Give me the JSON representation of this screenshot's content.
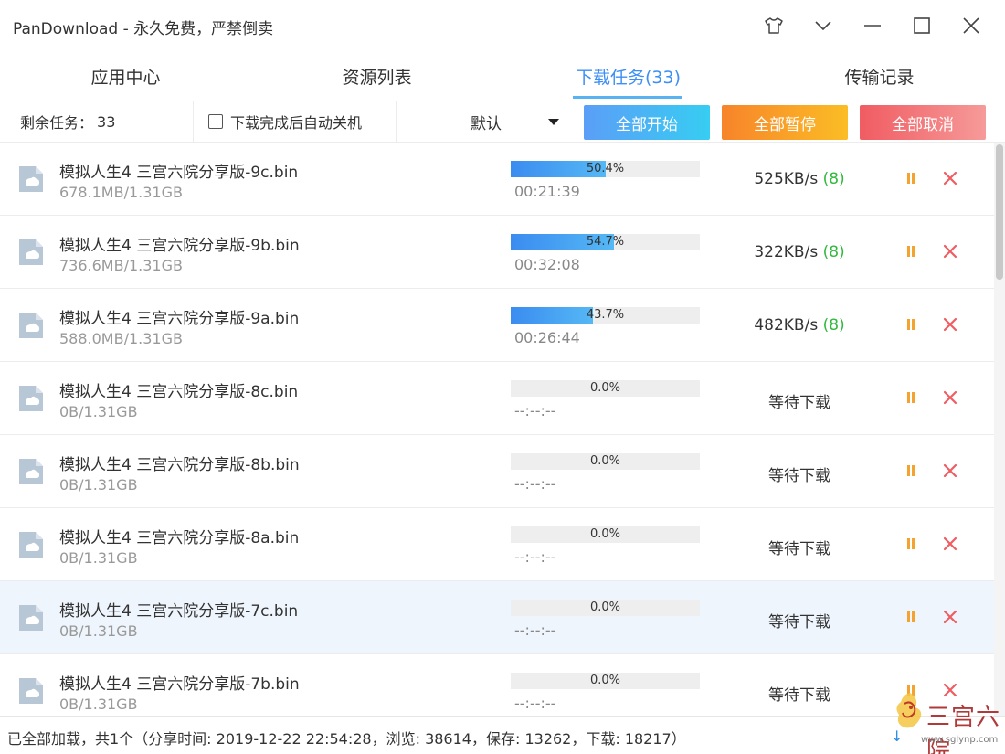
{
  "window": {
    "title": "PanDownload - 永久免费，严禁倒卖",
    "controls": [
      "shirt-icon",
      "chevron-down-icon",
      "minimize-icon",
      "maximize-icon",
      "close-icon"
    ]
  },
  "tabs": [
    {
      "label": "应用中心",
      "active": false
    },
    {
      "label": "资源列表",
      "active": false
    },
    {
      "label": "下载任务(33)",
      "active": true
    },
    {
      "label": "传输记录",
      "active": false
    }
  ],
  "toolbar": {
    "remaining_label": "剩余任务：",
    "remaining_count": "33",
    "auto_shutdown_label": "下载完成后自动关机",
    "auto_shutdown_checked": false,
    "sort_value": "默认",
    "start_all": "全部开始",
    "pause_all": "全部暂停",
    "cancel_all": "全部取消"
  },
  "colors": {
    "accent": "#3d8ff5",
    "progress": "#3b8cf0",
    "pause": "#f3a32e",
    "cancel": "#f05c62",
    "connections": "#31b93c",
    "highlight_row": "#eef5fd"
  },
  "tasks": [
    {
      "name": "模拟人生4 三宫六院分享版-9c.bin",
      "size": "678.1MB/1.31GB",
      "progress": 50.4,
      "progress_text": "50.4%",
      "time_left": "00:21:39",
      "speed": "525KB/s",
      "connections": "(8)",
      "status": "",
      "highlight": false
    },
    {
      "name": "模拟人生4 三宫六院分享版-9b.bin",
      "size": "736.6MB/1.31GB",
      "progress": 54.7,
      "progress_text": "54.7%",
      "time_left": "00:32:08",
      "speed": "322KB/s",
      "connections": "(8)",
      "status": "",
      "highlight": false
    },
    {
      "name": "模拟人生4 三宫六院分享版-9a.bin",
      "size": "588.0MB/1.31GB",
      "progress": 43.7,
      "progress_text": "43.7%",
      "time_left": "00:26:44",
      "speed": "482KB/s",
      "connections": "(8)",
      "status": "",
      "highlight": false
    },
    {
      "name": "模拟人生4 三宫六院分享版-8c.bin",
      "size": "0B/1.31GB",
      "progress": 0,
      "progress_text": "0.0%",
      "time_left": "--:--:--",
      "speed": "",
      "connections": "",
      "status": "等待下载",
      "highlight": false
    },
    {
      "name": "模拟人生4 三宫六院分享版-8b.bin",
      "size": "0B/1.31GB",
      "progress": 0,
      "progress_text": "0.0%",
      "time_left": "--:--:--",
      "speed": "",
      "connections": "",
      "status": "等待下载",
      "highlight": false
    },
    {
      "name": "模拟人生4 三宫六院分享版-8a.bin",
      "size": "0B/1.31GB",
      "progress": 0,
      "progress_text": "0.0%",
      "time_left": "--:--:--",
      "speed": "",
      "connections": "",
      "status": "等待下载",
      "highlight": false
    },
    {
      "name": "模拟人生4 三宫六院分享版-7c.bin",
      "size": "0B/1.31GB",
      "progress": 0,
      "progress_text": "0.0%",
      "time_left": "--:--:--",
      "speed": "",
      "connections": "",
      "status": "等待下载",
      "highlight": true
    },
    {
      "name": "模拟人生4 三宫六院分享版-7b.bin",
      "size": "0B/1.31GB",
      "progress": 0,
      "progress_text": "0.0%",
      "time_left": "--:--:--",
      "speed": "",
      "connections": "",
      "status": "等待下载",
      "highlight": false
    }
  ],
  "statusbar": {
    "text": "已全部加载，共1个（分享时间: 2019-12-22 22:54:28，浏览: 38614，保存: 13262，下载: 18217）",
    "arrow": "↓"
  },
  "watermark": {
    "text": "三宫六院",
    "url": "www.sglynp.com"
  }
}
